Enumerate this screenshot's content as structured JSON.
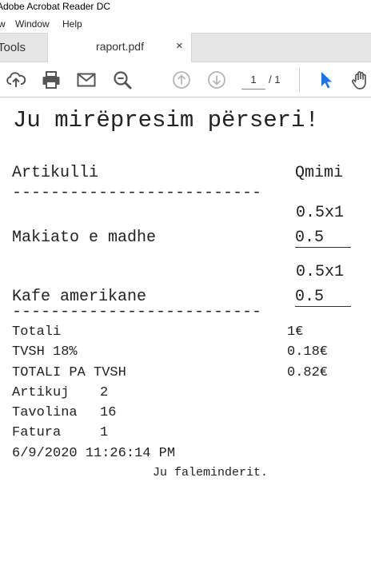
{
  "window": {
    "title": "Adobe Acrobat Reader DC"
  },
  "menu": {
    "items": [
      "w",
      "Window",
      "Help"
    ]
  },
  "tabs": {
    "tools": "Tools",
    "document": "raport.pdf",
    "close": "×"
  },
  "toolbar": {
    "icons": [
      "upload-icon",
      "print-icon",
      "mail-icon",
      "zoom-icon",
      "page-up-icon",
      "page-down-icon",
      "select-cursor-icon",
      "hand-icon"
    ],
    "page_current": "1",
    "page_total": "/ 1"
  },
  "receipt": {
    "heading": "Ju mirëpresim përseri!",
    "col_item": "Artikulli",
    "col_price": "Qmimi",
    "divider": "--------------------------",
    "items": [
      {
        "qty": "0.5x1",
        "name": "Makiato e madhe",
        "price": "0.5"
      },
      {
        "qty": "0.5x1",
        "name": "Kafe amerikane",
        "price": "0.5"
      }
    ],
    "totals": [
      {
        "label": "Totali",
        "value": "1€"
      },
      {
        "label": "TVSH 18%",
        "value": "0.18€"
      },
      {
        "label": "TOTALI PA TVSH",
        "value": "0.82€"
      }
    ],
    "info": [
      {
        "label": "Artikuj",
        "value": "2"
      },
      {
        "label": "Tavolina",
        "value": "16"
      },
      {
        "label": "Fatura",
        "value": "1"
      }
    ],
    "datetime": "6/9/2020 11:26:14 PM",
    "footer": "Ju faleminderit."
  },
  "colors": {
    "accent_blue": "#1a73e8",
    "icon_gray": "#555555",
    "disabled_gray": "#b5b5b5"
  }
}
